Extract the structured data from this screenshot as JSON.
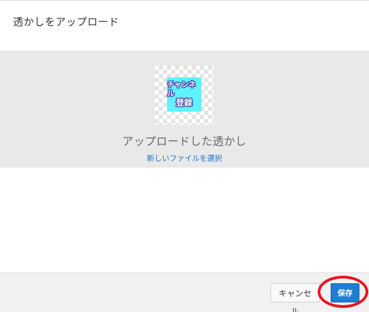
{
  "dialog": {
    "title": "透かしをアップロード"
  },
  "preview": {
    "watermark_line1": "チャンネル",
    "watermark_line2": "登録",
    "watermark_bg_color": "#5ef3ff",
    "uploaded_label": "アップロードした透かし",
    "select_file_link": "新しいファイルを選択"
  },
  "footer": {
    "cancel_label": "キャンセル",
    "save_label": "保存"
  },
  "colors": {
    "link": "#1a73c7",
    "primary_button": "#1d7ed2",
    "highlight_ring": "#e8141b",
    "preview_bg": "#e9e9e9",
    "footer_bg": "#f1f1f1"
  }
}
